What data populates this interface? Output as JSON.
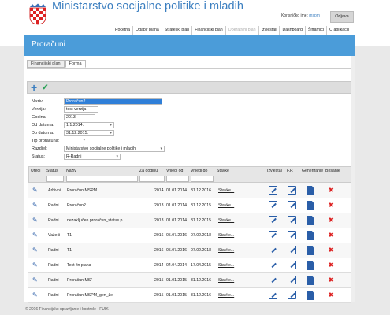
{
  "header": {
    "app_title": "Ministarstvo socijalne politike i mladih",
    "user_label": "Korisničko ime:",
    "user_name": "mspm",
    "logout_label": "Odjava",
    "menu": [
      {
        "label": "Početna",
        "enabled": true
      },
      {
        "label": "Odabir plana",
        "enabled": true
      },
      {
        "label": "Strateški plan",
        "enabled": true
      },
      {
        "label": "Financijski plan",
        "enabled": true
      },
      {
        "label": "Operativni plan",
        "enabled": false
      },
      {
        "label": "Izvještaji",
        "enabled": true
      },
      {
        "label": "Dashboard",
        "enabled": true
      },
      {
        "label": "Šifrarnici",
        "enabled": true
      },
      {
        "label": "O aplikaciji",
        "enabled": true
      }
    ]
  },
  "page": {
    "title": "Proračuni",
    "tabs": [
      "Financijski plan",
      "Forma"
    ],
    "active_tab": "Forma"
  },
  "form": {
    "naziv": {
      "label": "Naziv:",
      "value": "Proračun2"
    },
    "verzija": {
      "label": "Verzija:",
      "value": "test verzija"
    },
    "godina": {
      "label": "Godina:",
      "value": "2013"
    },
    "od_datuma": {
      "label": "Od datuma:",
      "value": "1.1.2014."
    },
    "do_datuma": {
      "label": "Do datuma:",
      "value": "31.12.2015."
    },
    "tip_proracuna": {
      "label": "Tip proračuna:",
      "value": ""
    },
    "razdjel": {
      "label": "Razdjel:",
      "value": "Ministarstvo socijalne politike i mladih"
    },
    "status": {
      "label": "Status:",
      "value": "R-Radni"
    }
  },
  "grid": {
    "columns": [
      "Uredi",
      "Status",
      "Naziv",
      "Za godinu",
      "Vrijedi od",
      "Vrijedi do",
      "Stavke",
      "Izvještaj",
      "F.P.",
      "Generiranje",
      "Brisanje"
    ],
    "stavke_label": "Stavke...",
    "rows": [
      {
        "status": "Arhivni",
        "naziv": "Proračun MSPM",
        "godina": "2014",
        "od": "01.01.2014",
        "do": "31.12.2016"
      },
      {
        "status": "Radni",
        "naziv": "Proračun2",
        "godina": "2013",
        "od": "01.01.2014",
        "do": "31.12.2015"
      },
      {
        "status": "Radni",
        "naziv": "nezaključen proračun_status p",
        "godina": "2013",
        "od": "01.01.2014",
        "do": "31.12.2015"
      },
      {
        "status": "Važeći",
        "naziv": "T1",
        "godina": "2016",
        "od": "05.07.2016",
        "do": "07.02.2018"
      },
      {
        "status": "Radni",
        "naziv": "T1",
        "godina": "2016",
        "od": "05.07.2016",
        "do": "07.02.2018"
      },
      {
        "status": "Radni",
        "naziv": "Test fin plana",
        "godina": "2014",
        "od": "04.04.2014",
        "do": "17.04.2015"
      },
      {
        "status": "Radni",
        "naziv": "Proračun MS\"",
        "godina": "2015",
        "od": "01.01.2015",
        "do": "31.12.2016"
      },
      {
        "status": "Radni",
        "naziv": "Proračun MSPM_gen_že",
        "godina": "2015",
        "od": "01.01.2015",
        "do": "31.12.2016"
      }
    ]
  },
  "footer": {
    "text": "© 2016 Financijsko upravljanje i kontrole - FUIK"
  },
  "colors": {
    "accent": "#4b9cd9",
    "title": "#3c7fc0",
    "edit": "#2a5ea8",
    "delete": "#dd2222",
    "confirm": "#2ea35a"
  }
}
